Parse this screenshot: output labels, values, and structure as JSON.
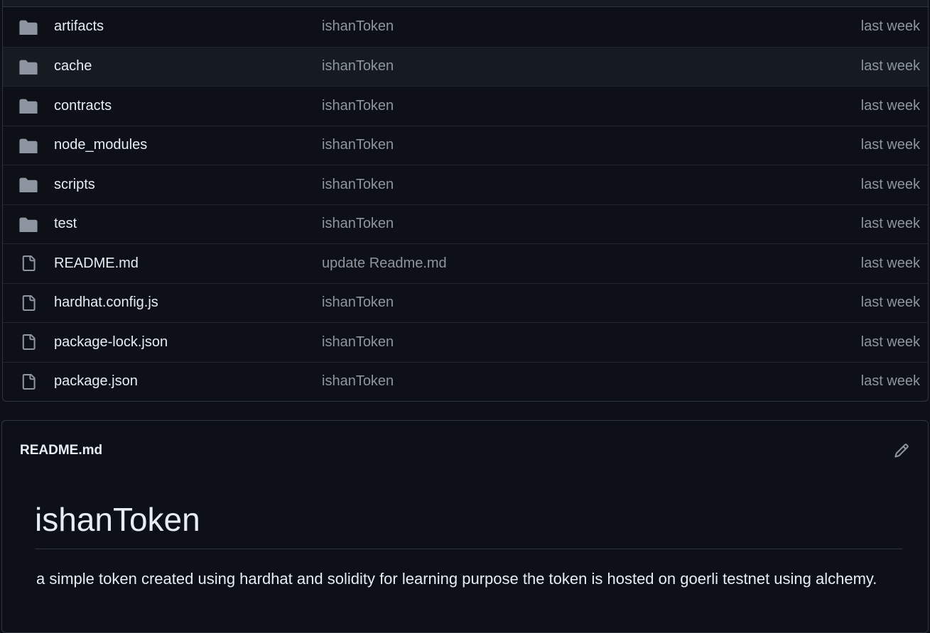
{
  "file_list": {
    "rows": [
      {
        "name": "artifacts",
        "type": "folder",
        "icon": "folder-icon",
        "commit": "ishanToken",
        "time": "last week"
      },
      {
        "name": "cache",
        "type": "folder",
        "icon": "folder-icon",
        "commit": "ishanToken",
        "time": "last week"
      },
      {
        "name": "contracts",
        "type": "folder",
        "icon": "folder-icon",
        "commit": "ishanToken",
        "time": "last week"
      },
      {
        "name": "node_modules",
        "type": "folder",
        "icon": "folder-icon",
        "commit": "ishanToken",
        "time": "last week"
      },
      {
        "name": "scripts",
        "type": "folder",
        "icon": "folder-icon",
        "commit": "ishanToken",
        "time": "last week"
      },
      {
        "name": "test",
        "type": "folder",
        "icon": "folder-icon",
        "commit": "ishanToken",
        "time": "last week"
      },
      {
        "name": "README.md",
        "type": "file",
        "icon": "file-icon",
        "commit": "update Readme.md",
        "time": "last week"
      },
      {
        "name": "hardhat.config.js",
        "type": "file",
        "icon": "file-icon",
        "commit": "ishanToken",
        "time": "last week"
      },
      {
        "name": "package-lock.json",
        "type": "file",
        "icon": "file-icon",
        "commit": "ishanToken",
        "time": "last week"
      },
      {
        "name": "package.json",
        "type": "file",
        "icon": "file-icon",
        "commit": "ishanToken",
        "time": "last week"
      }
    ]
  },
  "readme": {
    "filename": "README.md",
    "edit_icon": "pencil-icon",
    "title": "ishanToken",
    "description": "a simple token created using hardhat and solidity for learning purpose the token is hosted on goerli testnet using alchemy."
  },
  "colors": {
    "background": "#0d1117",
    "border": "#30363d",
    "text": "#e6edf3",
    "muted": "#8d96a0",
    "icon": "#8d96a0"
  }
}
